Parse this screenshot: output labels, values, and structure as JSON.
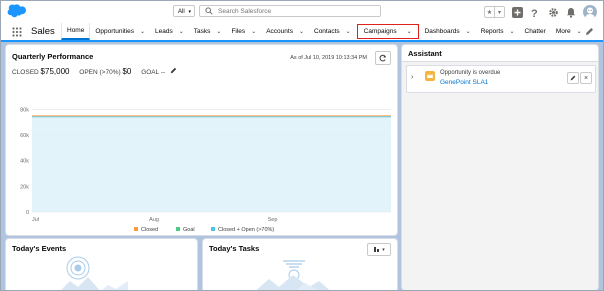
{
  "app": {
    "name": "Sales"
  },
  "search": {
    "scope": "All",
    "placeholder": "Search Salesforce"
  },
  "nav": {
    "tabs": [
      {
        "label": "Home",
        "dropdown": false
      },
      {
        "label": "Opportunities",
        "dropdown": true
      },
      {
        "label": "Leads",
        "dropdown": true
      },
      {
        "label": "Tasks",
        "dropdown": true
      },
      {
        "label": "Files",
        "dropdown": true
      },
      {
        "label": "Accounts",
        "dropdown": true
      },
      {
        "label": "Contacts",
        "dropdown": true
      },
      {
        "label": "Campaigns",
        "dropdown": true
      },
      {
        "label": "Dashboards",
        "dropdown": true
      },
      {
        "label": "Reports",
        "dropdown": true
      },
      {
        "label": "Chatter",
        "dropdown": false
      },
      {
        "label": "More",
        "dropdown": true
      }
    ],
    "active_tab": "Home",
    "highlighted_tab": "Campaigns"
  },
  "quarterly": {
    "title": "Quarterly Performance",
    "as_of": "As of Jul 10, 2019 10:13:34 PM",
    "closed_label": "CLOSED",
    "closed_value": "$75,000",
    "open_label": "OPEN (>70%)",
    "open_value": "$0",
    "goal_label": "GOAL",
    "goal_value": "--"
  },
  "chart_data": {
    "type": "line",
    "x_ticks": [
      "Jul",
      "Aug",
      "Sep"
    ],
    "y_ticks": [
      "0",
      "20k",
      "40k",
      "60k",
      "80k"
    ],
    "ylim": [
      0,
      85000
    ],
    "series": [
      {
        "name": "Closed",
        "color": "#ff9a3c",
        "values": [
          75000,
          75000
        ]
      },
      {
        "name": "Goal",
        "color": "#00a1e0",
        "values": []
      },
      {
        "name": "Closed + Open (>70%)",
        "color": "#4bc6e8",
        "values": [
          75000,
          75000
        ]
      }
    ],
    "legend": [
      "Closed",
      "Goal",
      "Closed + Open (>70%)"
    ],
    "legend_colors": [
      "#ff9a3c",
      "#4bca81",
      "#4bc6e8"
    ],
    "legend_position": "bottom",
    "grid": true
  },
  "assistant": {
    "title": "Assistant",
    "item_text": "Opportunity is overdue",
    "item_link": "GenePoint SLA1"
  },
  "events": {
    "title": "Today's Events"
  },
  "tasks": {
    "title": "Today's Tasks"
  }
}
